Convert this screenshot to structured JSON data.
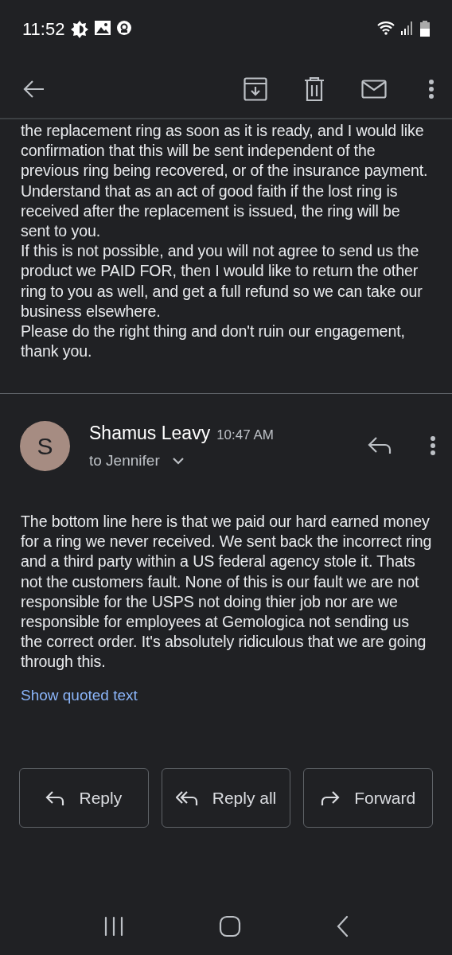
{
  "status_bar": {
    "time": "11:52"
  },
  "message_1": {
    "paragraphs": [
      "the replacement ring as soon as it is ready, and I would like confirmation that this will be sent independent of the previous ring being recovered, or of the insurance payment. Understand that as an act of good faith if the lost ring is received after the replacement is issued, the ring will be sent to you.",
      "If this is not possible, and you will not agree to send us the product we PAID FOR, then I would like to return the other ring to you as well, and get a full refund so we can take our business elsewhere.",
      "Please do the right thing and don't ruin our engagement, thank you."
    ]
  },
  "message_2": {
    "avatar_letter": "S",
    "sender": "Shamus Leavy",
    "time": "10:47 AM",
    "recipients": "to Jennifer",
    "body": "The bottom line here  is that we paid our hard earned money for a ring we never received.  We sent back the incorrect ring and a third party  within a US federal agency  stole it. Thats not the customers fault. None of this is our fault we are not responsible for the USPS not doing thier job nor are we responsible for employees at Gemologica not sending us the correct order. It's absolutely ridiculous that we are going through this.",
    "show_quoted": "Show quoted text"
  },
  "actions": [
    {
      "kind": "reply",
      "label": "Reply"
    },
    {
      "kind": "reply_all",
      "label": "Reply all"
    },
    {
      "kind": "forward",
      "label": "Forward"
    }
  ]
}
